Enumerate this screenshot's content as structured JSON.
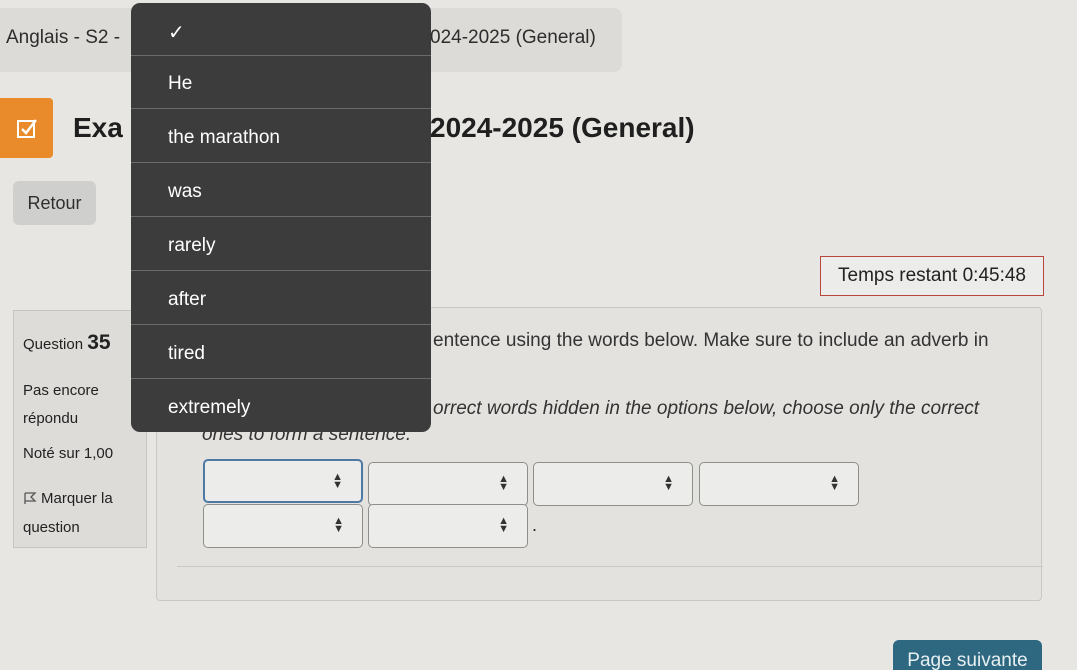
{
  "header": {
    "breadcrumb_left": "Anglais - S2 -",
    "breadcrumb_right": "024-2025 (General)"
  },
  "page": {
    "title_left": "Exa",
    "title_right": "2024-2025 (General)",
    "back_label": "Retour",
    "timer": "Temps restant 0:45:48"
  },
  "question_info": {
    "label": "Question",
    "number": "35",
    "status": "Pas encore répondu",
    "grade": "Noté sur 1,00",
    "flag_label": "Marquer la question"
  },
  "question": {
    "text_line1": "entence using the words below. Make sure to include an adverb in",
    "text_line2": "orrect words hidden in the options below, choose only the correct",
    "text_line3": "ones to form a sentence.",
    "period": "."
  },
  "dropdown": {
    "options": [
      "",
      "He",
      "the marathon",
      "was",
      "rarely",
      "after",
      "tired",
      "extremely"
    ],
    "selected_index": 0
  },
  "footer": {
    "next_label": "Page suivante"
  }
}
